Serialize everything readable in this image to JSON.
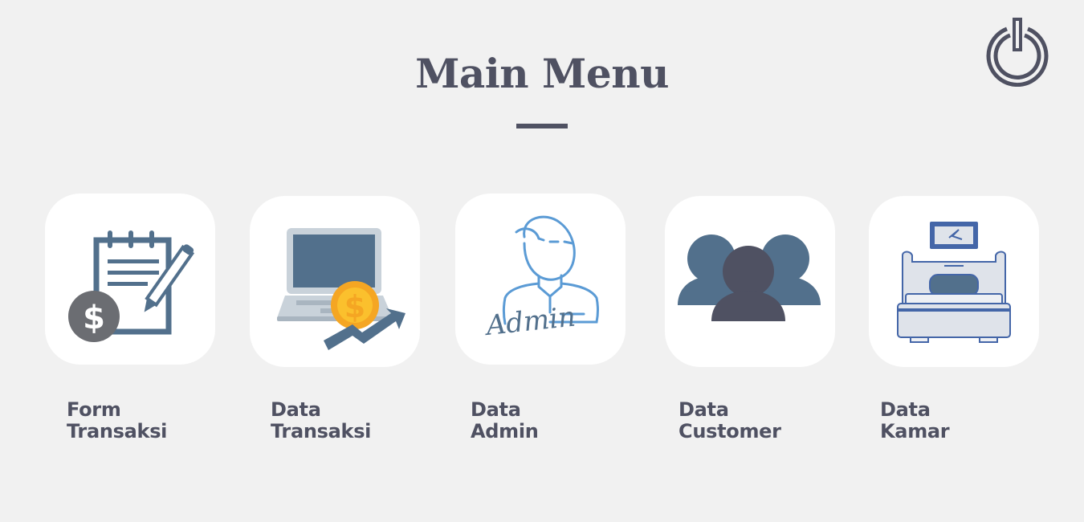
{
  "header": {
    "title": "Main Menu",
    "power_icon": "power-icon"
  },
  "menu": {
    "items": [
      {
        "line1": "Form",
        "line2": "Transaksi",
        "icon": "clipboard-invoice-icon"
      },
      {
        "line1": "Data",
        "line2": "Transaksi",
        "icon": "laptop-revenue-icon"
      },
      {
        "line1": "Data",
        "line2": "Admin",
        "icon": "admin-user-icon",
        "icon_text": "Admin"
      },
      {
        "line1": "Data",
        "line2": "Customer",
        "icon": "customers-group-icon"
      },
      {
        "line1": "Data",
        "line2": "Kamar",
        "icon": "hotel-bed-icon"
      }
    ]
  },
  "colors": {
    "background": "#f1f1f1",
    "text": "#4f5162",
    "accent_blue": "#52708c",
    "accent_gold": "#f5a623",
    "tile": "#ffffff"
  }
}
